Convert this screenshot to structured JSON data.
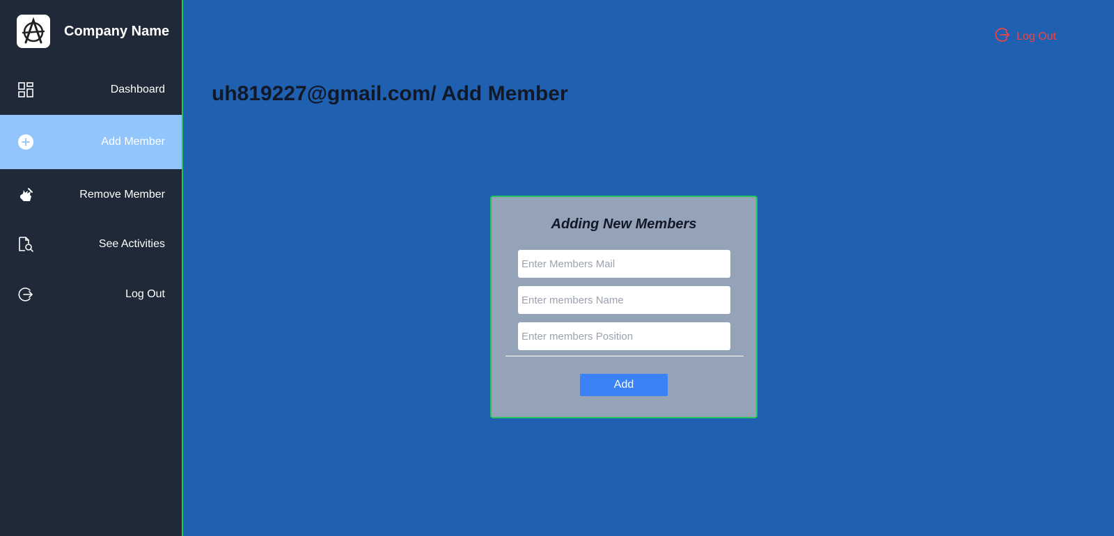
{
  "brand": {
    "name": "Company Name",
    "logo_icon": "anarchy-logo-icon"
  },
  "sidebar": {
    "items": [
      {
        "label": "Dashboard",
        "icon": "dashboard-grid-icon",
        "active": false
      },
      {
        "label": "Add Member",
        "icon": "plus-circle-icon",
        "active": true
      },
      {
        "label": "Remove Member",
        "icon": "hand-remove-icon",
        "active": false
      },
      {
        "label": "See Activities",
        "icon": "document-search-icon",
        "active": false
      },
      {
        "label": "Log Out",
        "icon": "logout-icon",
        "active": false
      }
    ]
  },
  "header": {
    "logout_label": "Log Out"
  },
  "page": {
    "title": "uh819227@gmail.com/ Add Member"
  },
  "form": {
    "title": "Adding New Members",
    "mail_placeholder": "Enter Members Mail",
    "name_placeholder": "Enter members Name",
    "position_placeholder": "Enter members Position",
    "mail_value": "",
    "name_value": "",
    "position_value": "",
    "submit_label": "Add"
  },
  "colors": {
    "background": "#2060b0",
    "sidebar": "#1f2937",
    "active_item": "#93c5fd",
    "card": "#94a3b8",
    "card_border": "#22c55e",
    "button": "#3b82f6",
    "logout": "#ef4444"
  }
}
